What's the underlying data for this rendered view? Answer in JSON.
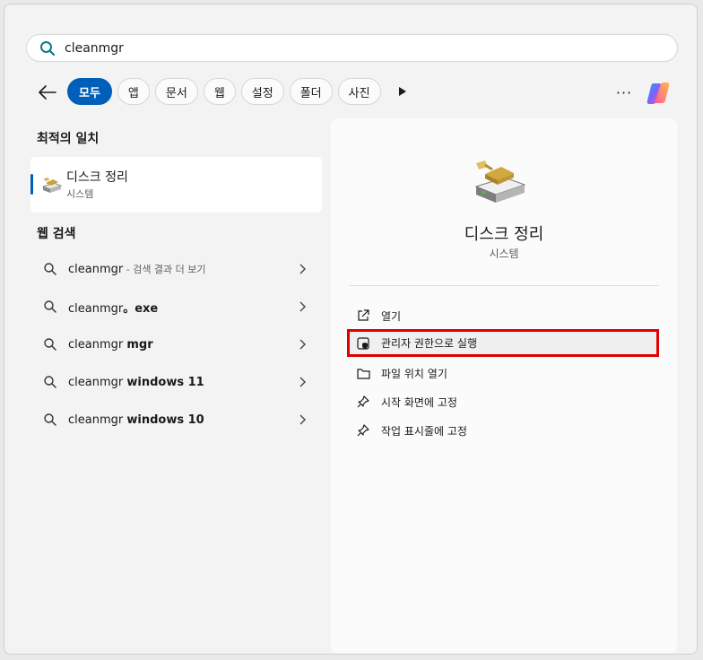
{
  "search": {
    "value": "cleanmgr"
  },
  "filters": [
    {
      "label": "모두",
      "active": true
    },
    {
      "label": "앱"
    },
    {
      "label": "문서"
    },
    {
      "label": "웹"
    },
    {
      "label": "설정"
    },
    {
      "label": "폴더"
    },
    {
      "label": "사진"
    }
  ],
  "left": {
    "best_match_title": "최적의 일치",
    "best_match": {
      "name": "디스크 정리",
      "type": "시스템"
    },
    "web_title": "웹 검색",
    "web_results": [
      {
        "bold": "cleanmgr",
        "normal": "",
        "muted": " - 검색 결과 더 보기"
      },
      {
        "bold": "cleanmgr",
        "normal": "。exe",
        "muted": ""
      },
      {
        "bold": "",
        "normal": "cleanmgr ",
        "extra_bold": "mgr"
      },
      {
        "bold": "",
        "normal": "cleanmgr ",
        "extra_bold": "windows 11"
      },
      {
        "bold": "",
        "normal": "cleanmgr ",
        "extra_bold": "windows 10"
      }
    ]
  },
  "detail": {
    "title": "디스크 정리",
    "subtitle": "시스템",
    "actions": [
      {
        "label": "열기",
        "icon": "open-external-icon"
      },
      {
        "label": "관리자 권한으로 실행",
        "icon": "shield-icon",
        "highlighted": true
      },
      {
        "label": "파일 위치 열기",
        "icon": "folder-icon"
      },
      {
        "label": "시작 화면에 고정",
        "icon": "pin-icon"
      },
      {
        "label": "작업 표시줄에 고정",
        "icon": "pin-icon"
      }
    ]
  },
  "colors": {
    "accent": "#005fb8",
    "highlight_border": "#e00000"
  }
}
